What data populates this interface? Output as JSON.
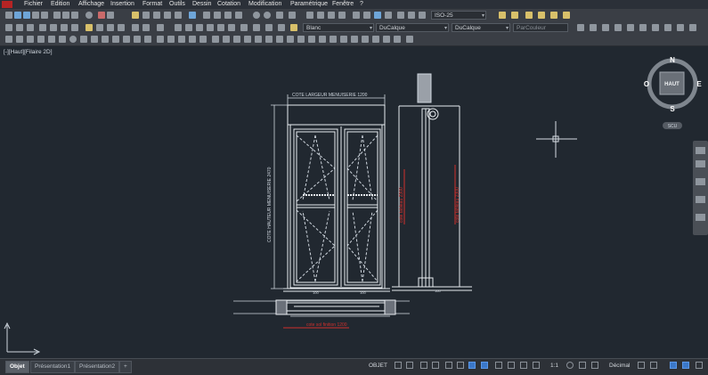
{
  "menu": [
    "Fichier",
    "Edition",
    "Affichage",
    "Insertion",
    "Format",
    "Outils",
    "Dessin",
    "Cotation",
    "Modification",
    "Paramétrique",
    "Fenêtre",
    "?"
  ],
  "toolbar": {
    "dim_style": "ISO-25",
    "layer": "Blanc",
    "linetype": "DuCalque",
    "lineweight": "DuCalque",
    "plotstyle": "ParCouleur"
  },
  "viewport_label": "[-][Haut][Filaire 2D]",
  "viewcube": {
    "north": "N",
    "south": "S",
    "east": "E",
    "west": "O",
    "face": "HAUT",
    "wcs": "SCU"
  },
  "drawing": {
    "top_dim": "COTE LARGEUR MENUISERIE 1200",
    "left_dim": "COTE HAUTEUR MENUISERIE 2470",
    "bottom_dim": "cote sol finition 1200",
    "section_dim_1": "cote tableau 2300",
    "section_dim_2": "cote tableau 2300",
    "small_labels": [
      "100",
      "100",
      "160"
    ]
  },
  "tabs": [
    "Objet",
    "Présentation1",
    "Présentation2",
    "+"
  ],
  "status": {
    "model": "OBJET",
    "scale": "1:1",
    "units": "Décimal"
  },
  "colors": {
    "canvas": "#212830",
    "line": "#e8ecf0",
    "dimension_red": "#d0302c",
    "accent_blue": "#3b78c9"
  }
}
